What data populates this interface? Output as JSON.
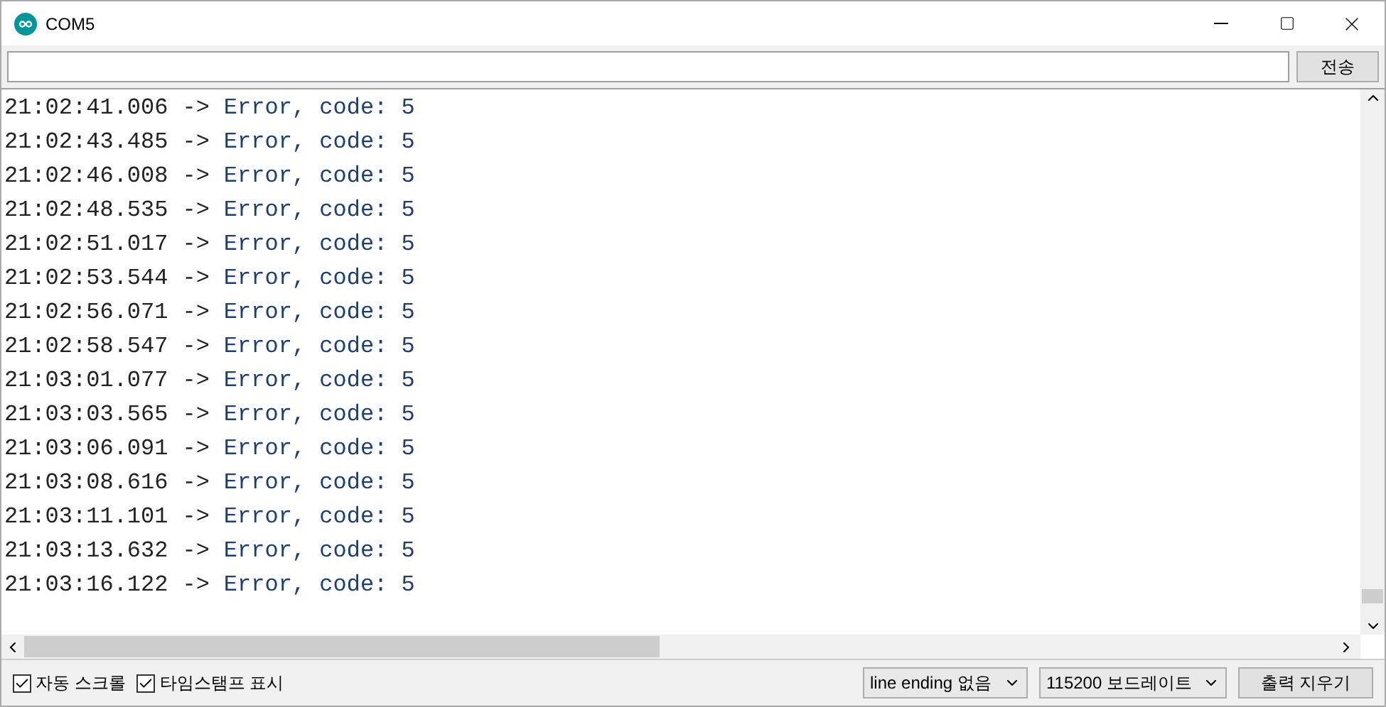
{
  "window": {
    "title": "COM5"
  },
  "send_button": "전송",
  "lines": [
    {
      "time": "21:02:41.006",
      "arrow": "->",
      "message": "Error, code: 5"
    },
    {
      "time": "21:02:43.485",
      "arrow": "->",
      "message": "Error, code: 5"
    },
    {
      "time": "21:02:46.008",
      "arrow": "->",
      "message": "Error, code: 5"
    },
    {
      "time": "21:02:48.535",
      "arrow": "->",
      "message": "Error, code: 5"
    },
    {
      "time": "21:02:51.017",
      "arrow": "->",
      "message": "Error, code: 5"
    },
    {
      "time": "21:02:53.544",
      "arrow": "->",
      "message": "Error, code: 5"
    },
    {
      "time": "21:02:56.071",
      "arrow": "->",
      "message": "Error, code: 5"
    },
    {
      "time": "21:02:58.547",
      "arrow": "->",
      "message": "Error, code: 5"
    },
    {
      "time": "21:03:01.077",
      "arrow": "->",
      "message": "Error, code: 5"
    },
    {
      "time": "21:03:03.565",
      "arrow": "->",
      "message": "Error, code: 5"
    },
    {
      "time": "21:03:06.091",
      "arrow": "->",
      "message": "Error, code: 5"
    },
    {
      "time": "21:03:08.616",
      "arrow": "->",
      "message": "Error, code: 5"
    },
    {
      "time": "21:03:11.101",
      "arrow": "->",
      "message": "Error, code: 5"
    },
    {
      "time": "21:03:13.632",
      "arrow": "->",
      "message": "Error, code: 5"
    },
    {
      "time": "21:03:16.122",
      "arrow": "->",
      "message": "Error, code: 5"
    }
  ],
  "checkboxes": [
    {
      "label": "자동 스크롤",
      "checked": true
    },
    {
      "label": "타임스탬프 표시",
      "checked": true
    }
  ],
  "line_ending": "line ending 없음",
  "baud_rate": "115200 보드레이트",
  "clear_button": "출력 지우기"
}
